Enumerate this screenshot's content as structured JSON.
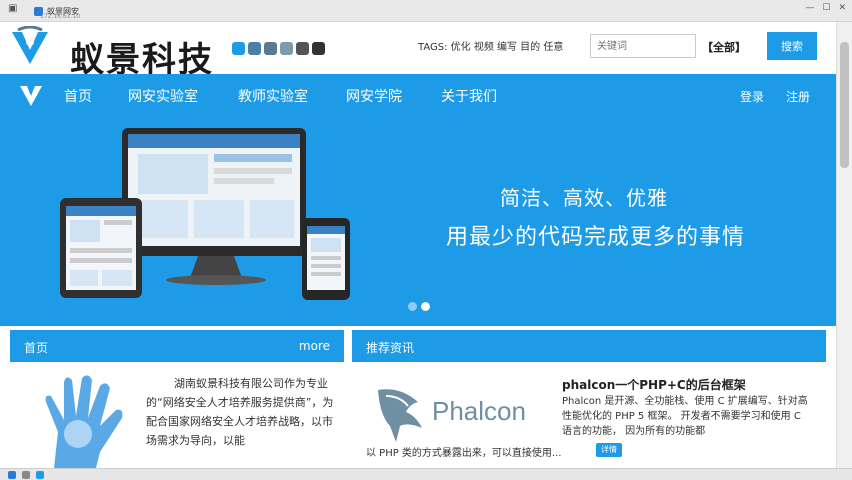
{
  "browser": {
    "tab_title": "蚁景网安",
    "address": "172.16.61.10",
    "controls": {
      "minimize": "—",
      "maximize": "☐",
      "close": "✕"
    }
  },
  "header": {
    "logo_text": "蚁景科技",
    "tags": "TAGS: 优化 视频 编写 目的 任意",
    "search_placeholder": "关键词",
    "scope": "【全部】",
    "search_button": "搜索",
    "dot_colors": [
      "#1e9be6",
      "#4a7fa8",
      "#5a7a93",
      "#7f9aaa",
      "#555555",
      "#333333"
    ]
  },
  "nav": {
    "items": [
      "首页",
      "网安实验室",
      "教师实验室",
      "网安学院",
      "关于我们"
    ],
    "login": "登录",
    "register": "注册"
  },
  "banner": {
    "slogan_line1": "简洁、高效、优雅",
    "slogan_line2": "用最少的代码完成更多的事情",
    "active_slide": 2,
    "slide_count": 2
  },
  "about_panel": {
    "title": "首页",
    "more": "more",
    "text": "湖南蚁景科技有限公司作为专业的“网络安全人才培养服务提供商”，为配合国家网络安全人才培养战略，以市场需求为导向，以能"
  },
  "news_panel": {
    "title": "推荐资讯",
    "logo_word": "Phalcon",
    "item_title": "phalcon一个PHP+C的后台框架",
    "item_body": "Phalcon 是开源、全功能栈、使用 C 扩展编写、针对高性能优化的 PHP 5 框架。 开发者不需要学习和使用 C 语言的功能， 因为所有的功能都",
    "item_tail": "以 PHP 类的方式暴露出来，可以直接使用...",
    "detail_button": "详情"
  },
  "theme": {
    "primary": "#1e9be6",
    "text_dark": "#222222"
  }
}
